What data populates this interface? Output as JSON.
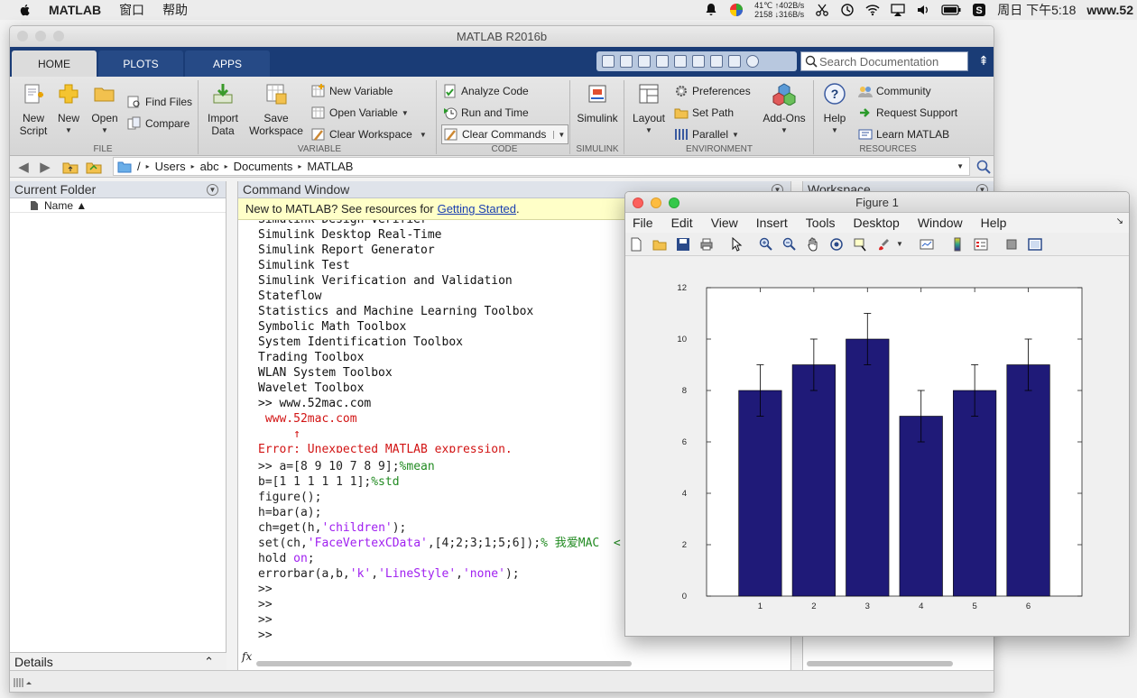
{
  "menubar": {
    "app_name": "MATLAB",
    "items": [
      "窗口",
      "帮助"
    ],
    "temp": "41℃",
    "net_up": "↑402B/s",
    "cpu_fan": "2158",
    "net_down": "↓316B/s",
    "clock": "周日 下午5:18",
    "site": "www.52"
  },
  "matlab": {
    "title": "MATLAB R2016b",
    "tabs": [
      "HOME",
      "PLOTS",
      "APPS"
    ],
    "search_placeholder": "Search Documentation",
    "ribbon": {
      "new_script": "New\nScript",
      "new": "New",
      "open": "Open",
      "find_files": "Find Files",
      "compare": "Compare",
      "import_data": "Import\nData",
      "save_workspace": "Save\nWorkspace",
      "new_variable": "New Variable",
      "open_variable": "Open Variable",
      "clear_workspace": "Clear Workspace",
      "analyze_code": "Analyze Code",
      "run_and_time": "Run and Time",
      "clear_commands": "Clear Commands",
      "simulink": "Simulink",
      "layout": "Layout",
      "preferences": "Preferences",
      "set_path": "Set Path",
      "parallel": "Parallel",
      "add_ons": "Add-Ons",
      "help": "Help",
      "community": "Community",
      "request_support": "Request Support",
      "learn_matlab": "Learn MATLAB",
      "sections": [
        "FILE",
        "VARIABLE",
        "CODE",
        "SIMULINK",
        "ENVIRONMENT",
        "RESOURCES"
      ]
    },
    "path": [
      "/",
      "Users",
      "abc",
      "Documents",
      "MATLAB"
    ],
    "current_folder": {
      "title": "Current Folder",
      "column_header": "Name ▲"
    },
    "details_label": "Details",
    "command_window": {
      "title": "Command Window",
      "info_text": "New to MATLAB? See resources for",
      "info_link": "Getting Started",
      "info_end": ".",
      "prev_line": "Simulink Design Verifier",
      "lines": [
        "Simulink Desktop Real-Time",
        "Simulink Report Generator",
        "Simulink Test",
        "Simulink Verification and Validation",
        "Stateflow",
        "Statistics and Machine Learning Toolbox",
        "Symbolic Math Toolbox",
        "System Identification Toolbox",
        "Trading Toolbox",
        "WLAN System Toolbox",
        "Wavelet Toolbox"
      ],
      "cmd_url": ">> www.52mac.com",
      "err_echo": " www.52mac.com",
      "err_caret": "     ↑",
      "err_msg": "Error: Unexpected MATLAB expression.",
      "code": {
        "l1a": ">> a=[8 9 10 7 8 9];",
        "l1c": "%mean",
        "l2a": "b=[1 1 1 1 1 1];",
        "l2c": "%std",
        "l3": "figure();",
        "l4": "h=bar(a);",
        "l5a": "ch=get(h,",
        "l5s": "'children'",
        "l5b": ");",
        "l6a": "set(ch,",
        "l6s": "'FaceVertexCData'",
        "l6b": ",[4;2;3;1;5;6]);",
        "l6c": "% 我爱MAC  <",
        "l7a": "hold ",
        "l7s": "on",
        "l7b": ";",
        "l8a": "errorbar(a,b,",
        "l8s1": "'k'",
        "l8m": ",",
        "l8s2": "'LineStyle'",
        "l8m2": ",",
        "l8s3": "'none'",
        "l8b": ");",
        "prompts": [
          ">>",
          ">>",
          ">>",
          ">>"
        ]
      },
      "fx": "fx"
    },
    "workspace_title": "Workspace"
  },
  "figure": {
    "title": "Figure 1",
    "menu": [
      "File",
      "Edit",
      "View",
      "Insert",
      "Tools",
      "Desktop",
      "Window",
      "Help"
    ]
  },
  "chart_data": {
    "type": "bar",
    "categories": [
      "1",
      "2",
      "3",
      "4",
      "5",
      "6"
    ],
    "values": [
      8,
      9,
      10,
      7,
      8,
      9
    ],
    "errors": [
      1,
      1,
      1,
      1,
      1,
      1
    ],
    "ylim": [
      0,
      12
    ],
    "yticks": [
      0,
      2,
      4,
      6,
      8,
      10,
      12
    ],
    "bar_color": "#1f1a78",
    "errorbar_color": "#000000",
    "title": "",
    "xlabel": "",
    "ylabel": ""
  },
  "colors": {
    "ribbon_tab_bg": "#1a3c76",
    "error_text": "#d21414",
    "comment": "#228b22",
    "string": "#a020f0"
  }
}
